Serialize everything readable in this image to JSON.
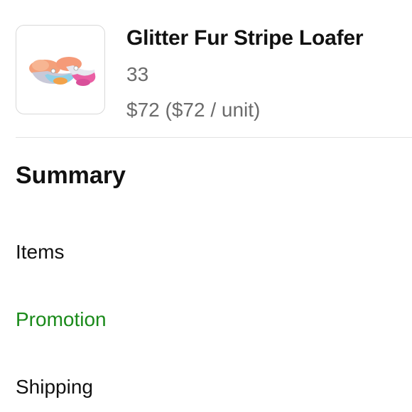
{
  "product": {
    "title": "Glitter Fur Stripe Loafer",
    "size": "33",
    "price": "$72 ($72 / unit)"
  },
  "summary": {
    "title": "Summary",
    "rows": [
      {
        "label": "Items"
      },
      {
        "label": "Promotion"
      },
      {
        "label": "Shipping"
      }
    ]
  },
  "colors": {
    "text_primary": "#111111",
    "text_secondary": "#6b6b6b",
    "promotion": "#1a8a1a",
    "divider": "#e3e3e3"
  }
}
